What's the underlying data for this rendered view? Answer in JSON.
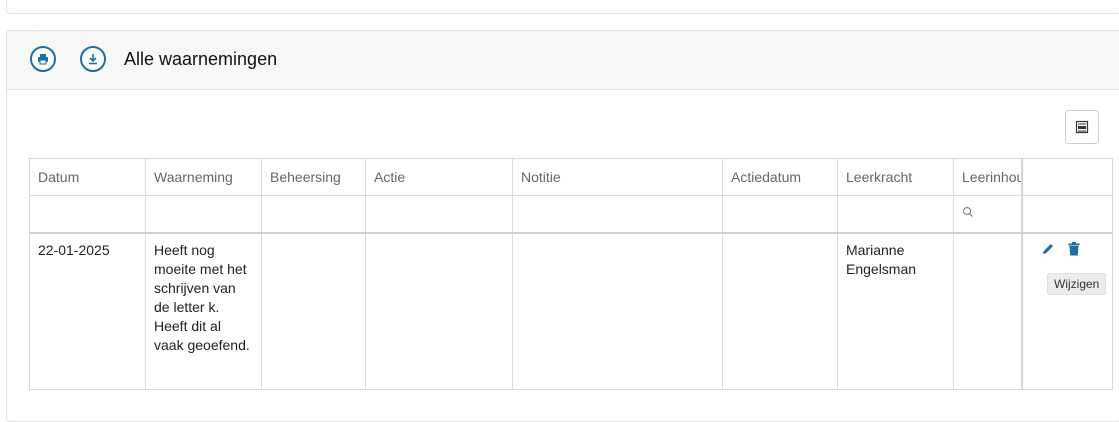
{
  "panel": {
    "title": "Alle waarnemingen",
    "print_icon": "print-icon",
    "download_icon": "download-icon",
    "export_icon": "excel-export-icon"
  },
  "table": {
    "columns": [
      "Datum",
      "Waarneming",
      "Beheersing",
      "Actie",
      "Notitie",
      "Actiedatum",
      "Leerkracht",
      "Leerinhoud",
      ""
    ],
    "rows": [
      {
        "datum": "22-01-2025",
        "waarneming": "Heeft nog moeite met het schrijven van de letter k. Heeft dit al vaak geoefend.",
        "beheersing": "",
        "actie": "",
        "notitie": "",
        "actiedatum": "",
        "leerkracht": "Marianne Engelsman",
        "leerinhoud": ""
      }
    ],
    "actions": {
      "edit_icon": "pencil-icon",
      "delete_icon": "trash-icon"
    }
  },
  "tooltip": {
    "text": "Wijzigen"
  },
  "colors": {
    "accent": "#1a6fa8",
    "border": "#dcdcdc",
    "header_bg": "#f7f7f7"
  }
}
